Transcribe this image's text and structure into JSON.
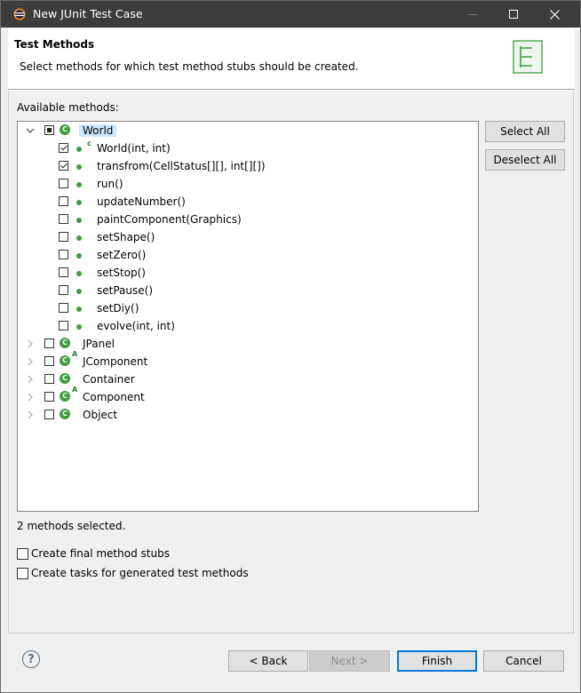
{
  "window": {
    "title": "New JUnit Test Case",
    "icon": "eclipse-icon"
  },
  "header": {
    "title": "Test Methods",
    "description": "Select methods for which test method stubs should be created."
  },
  "available_label": "Available methods:",
  "tree": {
    "root": {
      "label": "World",
      "state": "partial",
      "expanded": true,
      "methods": [
        {
          "label": "World(int, int)",
          "checked": true,
          "constructor": true
        },
        {
          "label": "transfrom(CellStatus[][], int[][])",
          "checked": true,
          "constructor": false
        },
        {
          "label": "run()",
          "checked": false,
          "constructor": false
        },
        {
          "label": "updateNumber()",
          "checked": false,
          "constructor": false
        },
        {
          "label": "paintComponent(Graphics)",
          "checked": false,
          "constructor": false
        },
        {
          "label": "setShape()",
          "checked": false,
          "constructor": false
        },
        {
          "label": "setZero()",
          "checked": false,
          "constructor": false
        },
        {
          "label": "setStop()",
          "checked": false,
          "constructor": false
        },
        {
          "label": "setPause()",
          "checked": false,
          "constructor": false
        },
        {
          "label": "setDiy()",
          "checked": false,
          "constructor": false
        },
        {
          "label": "evolve(int, int)",
          "checked": false,
          "constructor": false
        }
      ]
    },
    "supertypes": [
      {
        "label": "JPanel",
        "abstract": false
      },
      {
        "label": "JComponent",
        "abstract": true
      },
      {
        "label": "Container",
        "abstract": false
      },
      {
        "label": "Component",
        "abstract": true
      },
      {
        "label": "Object",
        "abstract": false
      }
    ]
  },
  "buttons": {
    "select_all": "Select All",
    "deselect_all": "Deselect All",
    "back": "< Back",
    "next": "Next >",
    "finish": "Finish",
    "cancel": "Cancel"
  },
  "status": "2 methods selected.",
  "options": {
    "final_stubs": "Create final method stubs",
    "tasks": "Create tasks for generated test methods"
  },
  "help_symbol": "?"
}
